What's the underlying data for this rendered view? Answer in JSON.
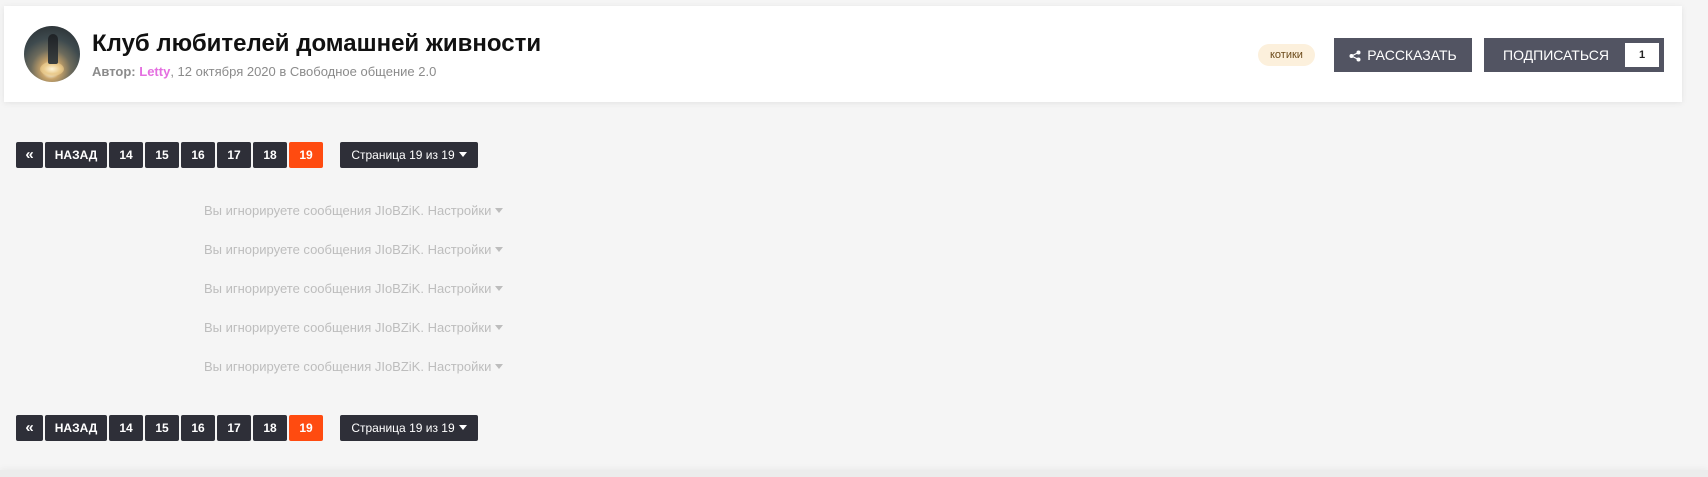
{
  "header": {
    "title": "Клуб любителей домашней живности",
    "meta": {
      "author_label": "Автор:",
      "author": "Letty",
      "rest": ", 12 октября 2020 в Свободное общение 2.0"
    },
    "tag": "котики",
    "share_label": "РАССКАЗАТЬ",
    "subscribe_label": "ПОДПИСАТЬСЯ",
    "subscribe_count": "1"
  },
  "pagination": {
    "first": "«",
    "back": "НАЗАД",
    "pages": [
      "14",
      "15",
      "16",
      "17",
      "18",
      "19"
    ],
    "active_page": "19",
    "jump_label": "Страница 19 из 19"
  },
  "ignored_posts": [
    {
      "text": "Вы игнорируете сообщения JIoBZiK.",
      "settings": "Настройки"
    },
    {
      "text": "Вы игнорируете сообщения JIoBZiK.",
      "settings": "Настройки"
    },
    {
      "text": "Вы игнорируете сообщения JIoBZiK.",
      "settings": "Настройки"
    },
    {
      "text": "Вы игнорируете сообщения JIoBZiK.",
      "settings": "Настройки"
    },
    {
      "text": "Вы игнорируете сообщения JIoBZiK.",
      "settings": "Настройки"
    }
  ],
  "icons": {
    "share": "share-icon",
    "caret": "caret-down-icon",
    "first": "double-chevron-left-icon"
  },
  "colors": {
    "accent": "#ff4b10",
    "button": "#525462",
    "pager": "#2e2f38",
    "author": "#e46fe0",
    "tag_bg": "#fcf0dc"
  }
}
